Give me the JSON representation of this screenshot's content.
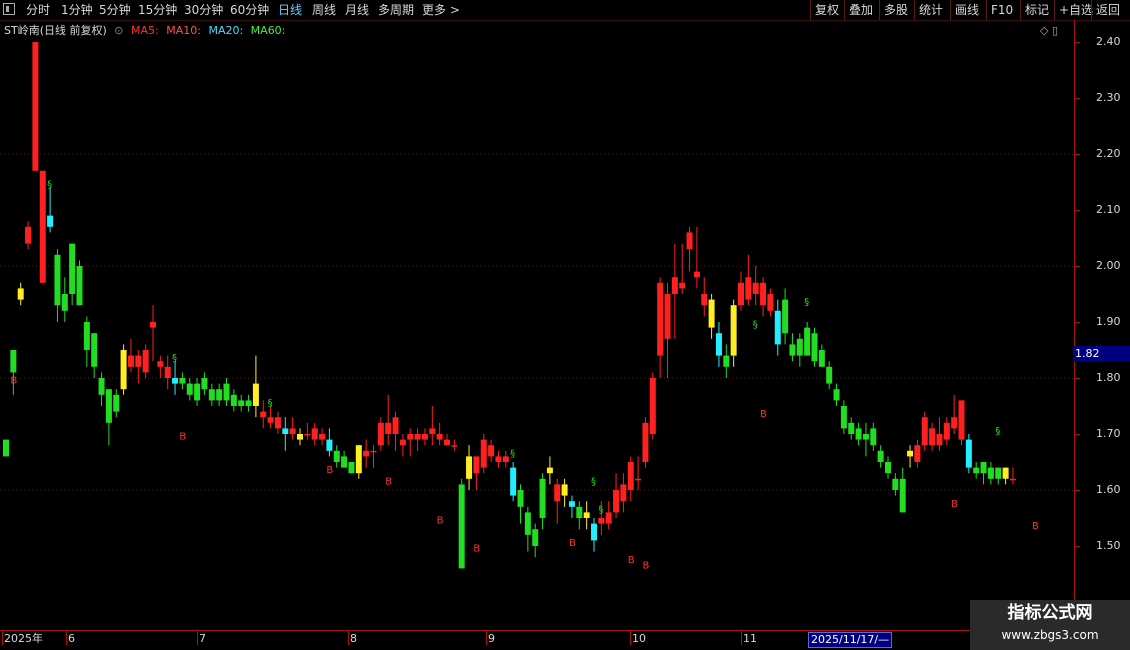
{
  "toolbar": {
    "left_items": [
      "分时",
      "1分钟",
      "5分钟",
      "15分钟",
      "30分钟",
      "60分钟",
      "日线",
      "周线",
      "月线",
      "多周期",
      "更多 >"
    ],
    "active": "日线",
    "right_items": [
      "复权",
      "叠加",
      "多股",
      "统计",
      "画线",
      "F10",
      "标记",
      "+自选",
      "返回"
    ]
  },
  "legend": {
    "stock": "ST岭南(日线 前复权)",
    "ma5": "MA5:",
    "ma10": "MA10:",
    "ma20": "MA20:",
    "ma60": "MA60:"
  },
  "colors": {
    "up": "#ff2020",
    "down": "#22dd22",
    "yellow": "#ffee22",
    "cyan": "#22eeff",
    "signal_b": "#ff3030",
    "signal_mark": "#22dd22"
  },
  "price_axis": {
    "labels": [
      "2.40",
      "2.30",
      "2.20",
      "2.10",
      "2.00",
      "1.90",
      "1.80",
      "1.70",
      "1.60",
      "1.50"
    ],
    "current_price": "1.82"
  },
  "x_axis": {
    "labels": [
      "2025年",
      "6",
      "7",
      "8",
      "9",
      "10",
      "11"
    ],
    "cursor_date": "2025/11/17/—"
  },
  "watermark": {
    "title": "指标公式网",
    "url": "www.zbgs3.com"
  },
  "chart_data": {
    "type": "candlestick",
    "ylim": [
      1.42,
      2.43
    ],
    "candles": [
      {
        "o": 1.66,
        "c": 1.69,
        "h": 1.69,
        "l": 1.66,
        "col": "down"
      },
      {
        "o": 1.81,
        "c": 1.85,
        "h": 1.85,
        "l": 1.77,
        "col": "down"
      },
      {
        "o": 1.94,
        "c": 1.96,
        "h": 1.97,
        "l": 1.93,
        "col": "yellow"
      },
      {
        "o": 2.04,
        "c": 2.07,
        "h": 2.08,
        "l": 2.03,
        "col": "up"
      },
      {
        "o": 2.17,
        "c": 2.4,
        "h": 2.4,
        "l": 2.17,
        "col": "up"
      },
      {
        "o": 1.97,
        "c": 2.17,
        "h": 2.17,
        "l": 1.97,
        "col": "up"
      },
      {
        "o": 2.09,
        "c": 2.07,
        "h": 2.14,
        "l": 2.06,
        "col": "cyan"
      },
      {
        "o": 2.02,
        "c": 1.93,
        "h": 2.03,
        "l": 1.9,
        "col": "down"
      },
      {
        "o": 1.95,
        "c": 1.92,
        "h": 1.98,
        "l": 1.9,
        "col": "down"
      },
      {
        "o": 2.04,
        "c": 1.95,
        "h": 2.04,
        "l": 1.93,
        "col": "down"
      },
      {
        "o": 2.0,
        "c": 1.93,
        "h": 2.01,
        "l": 1.93,
        "col": "down"
      },
      {
        "o": 1.9,
        "c": 1.85,
        "h": 1.91,
        "l": 1.82,
        "col": "down"
      },
      {
        "o": 1.88,
        "c": 1.82,
        "h": 1.88,
        "l": 1.8,
        "col": "down"
      },
      {
        "o": 1.8,
        "c": 1.77,
        "h": 1.81,
        "l": 1.75,
        "col": "down"
      },
      {
        "o": 1.78,
        "c": 1.72,
        "h": 1.78,
        "l": 1.68,
        "col": "down"
      },
      {
        "o": 1.74,
        "c": 1.77,
        "h": 1.78,
        "l": 1.73,
        "col": "down"
      },
      {
        "o": 1.78,
        "c": 1.85,
        "h": 1.86,
        "l": 1.77,
        "col": "yellow"
      },
      {
        "o": 1.82,
        "c": 1.84,
        "h": 1.87,
        "l": 1.81,
        "col": "up"
      },
      {
        "o": 1.84,
        "c": 1.82,
        "h": 1.85,
        "l": 1.79,
        "col": "up"
      },
      {
        "o": 1.85,
        "c": 1.81,
        "h": 1.86,
        "l": 1.8,
        "col": "up"
      },
      {
        "o": 1.9,
        "c": 1.89,
        "h": 1.93,
        "l": 1.83,
        "col": "up"
      },
      {
        "o": 1.83,
        "c": 1.82,
        "h": 1.84,
        "l": 1.8,
        "col": "up"
      },
      {
        "o": 1.82,
        "c": 1.8,
        "h": 1.84,
        "l": 1.78,
        "col": "up"
      },
      {
        "o": 1.8,
        "c": 1.79,
        "h": 1.83,
        "l": 1.77,
        "col": "cyan"
      },
      {
        "o": 1.8,
        "c": 1.79,
        "h": 1.81,
        "l": 1.78,
        "col": "down"
      },
      {
        "o": 1.79,
        "c": 1.77,
        "h": 1.8,
        "l": 1.76,
        "col": "down"
      },
      {
        "o": 1.79,
        "c": 1.76,
        "h": 1.8,
        "l": 1.75,
        "col": "down"
      },
      {
        "o": 1.8,
        "c": 1.78,
        "h": 1.81,
        "l": 1.77,
        "col": "down"
      },
      {
        "o": 1.78,
        "c": 1.76,
        "h": 1.79,
        "l": 1.75,
        "col": "down"
      },
      {
        "o": 1.78,
        "c": 1.76,
        "h": 1.79,
        "l": 1.75,
        "col": "down"
      },
      {
        "o": 1.79,
        "c": 1.76,
        "h": 1.8,
        "l": 1.75,
        "col": "down"
      },
      {
        "o": 1.77,
        "c": 1.75,
        "h": 1.78,
        "l": 1.74,
        "col": "down"
      },
      {
        "o": 1.76,
        "c": 1.75,
        "h": 1.77,
        "l": 1.74,
        "col": "down"
      },
      {
        "o": 1.76,
        "c": 1.75,
        "h": 1.77,
        "l": 1.74,
        "col": "down"
      },
      {
        "o": 1.75,
        "c": 1.79,
        "h": 1.84,
        "l": 1.73,
        "col": "yellow"
      },
      {
        "o": 1.74,
        "c": 1.73,
        "h": 1.76,
        "l": 1.71,
        "col": "up"
      },
      {
        "o": 1.73,
        "c": 1.72,
        "h": 1.75,
        "l": 1.71,
        "col": "up"
      },
      {
        "o": 1.73,
        "c": 1.71,
        "h": 1.74,
        "l": 1.7,
        "col": "up"
      },
      {
        "o": 1.71,
        "c": 1.7,
        "h": 1.73,
        "l": 1.67,
        "col": "cyan"
      },
      {
        "o": 1.71,
        "c": 1.7,
        "h": 1.73,
        "l": 1.69,
        "col": "up"
      },
      {
        "o": 1.7,
        "c": 1.69,
        "h": 1.71,
        "l": 1.68,
        "col": "yellow"
      },
      {
        "o": 1.7,
        "c": 1.7,
        "h": 1.72,
        "l": 1.69,
        "col": "up"
      },
      {
        "o": 1.71,
        "c": 1.69,
        "h": 1.72,
        "l": 1.68,
        "col": "up"
      },
      {
        "o": 1.7,
        "c": 1.69,
        "h": 1.71,
        "l": 1.68,
        "col": "up"
      },
      {
        "o": 1.69,
        "c": 1.67,
        "h": 1.71,
        "l": 1.66,
        "col": "cyan"
      },
      {
        "o": 1.67,
        "c": 1.65,
        "h": 1.68,
        "l": 1.64,
        "col": "down"
      },
      {
        "o": 1.66,
        "c": 1.64,
        "h": 1.67,
        "l": 1.64,
        "col": "down"
      },
      {
        "o": 1.65,
        "c": 1.63,
        "h": 1.65,
        "l": 1.63,
        "col": "down"
      },
      {
        "o": 1.63,
        "c": 1.68,
        "h": 1.68,
        "l": 1.62,
        "col": "yellow"
      },
      {
        "o": 1.66,
        "c": 1.67,
        "h": 1.69,
        "l": 1.64,
        "col": "up"
      },
      {
        "o": 1.67,
        "c": 1.67,
        "h": 1.68,
        "l": 1.64,
        "col": "up"
      },
      {
        "o": 1.68,
        "c": 1.72,
        "h": 1.73,
        "l": 1.67,
        "col": "up"
      },
      {
        "o": 1.72,
        "c": 1.7,
        "h": 1.77,
        "l": 1.68,
        "col": "up"
      },
      {
        "o": 1.7,
        "c": 1.73,
        "h": 1.74,
        "l": 1.67,
        "col": "up"
      },
      {
        "o": 1.68,
        "c": 1.69,
        "h": 1.7,
        "l": 1.66,
        "col": "up"
      },
      {
        "o": 1.7,
        "c": 1.69,
        "h": 1.71,
        "l": 1.66,
        "col": "up"
      },
      {
        "o": 1.7,
        "c": 1.69,
        "h": 1.71,
        "l": 1.67,
        "col": "up"
      },
      {
        "o": 1.7,
        "c": 1.69,
        "h": 1.71,
        "l": 1.68,
        "col": "up"
      },
      {
        "o": 1.7,
        "c": 1.71,
        "h": 1.75,
        "l": 1.68,
        "col": "up"
      },
      {
        "o": 1.7,
        "c": 1.69,
        "h": 1.72,
        "l": 1.68,
        "col": "up"
      },
      {
        "o": 1.69,
        "c": 1.68,
        "h": 1.7,
        "l": 1.68,
        "col": "up"
      },
      {
        "o": 1.68,
        "c": 1.68,
        "h": 1.69,
        "l": 1.67,
        "col": "up"
      },
      {
        "o": 1.61,
        "c": 1.46,
        "h": 1.62,
        "l": 1.46,
        "col": "down"
      },
      {
        "o": 1.62,
        "c": 1.66,
        "h": 1.68,
        "l": 1.6,
        "col": "yellow"
      },
      {
        "o": 1.66,
        "c": 1.63,
        "h": 1.66,
        "l": 1.6,
        "col": "up"
      },
      {
        "o": 1.64,
        "c": 1.69,
        "h": 1.7,
        "l": 1.63,
        "col": "up"
      },
      {
        "o": 1.66,
        "c": 1.68,
        "h": 1.69,
        "l": 1.65,
        "col": "up"
      },
      {
        "o": 1.66,
        "c": 1.65,
        "h": 1.67,
        "l": 1.64,
        "col": "up"
      },
      {
        "o": 1.66,
        "c": 1.65,
        "h": 1.67,
        "l": 1.64,
        "col": "up"
      },
      {
        "o": 1.64,
        "c": 1.59,
        "h": 1.65,
        "l": 1.58,
        "col": "cyan"
      },
      {
        "o": 1.6,
        "c": 1.57,
        "h": 1.61,
        "l": 1.54,
        "col": "down"
      },
      {
        "o": 1.56,
        "c": 1.52,
        "h": 1.57,
        "l": 1.49,
        "col": "down"
      },
      {
        "o": 1.53,
        "c": 1.5,
        "h": 1.54,
        "l": 1.48,
        "col": "down"
      },
      {
        "o": 1.55,
        "c": 1.62,
        "h": 1.63,
        "l": 1.53,
        "col": "down"
      },
      {
        "o": 1.63,
        "c": 1.64,
        "h": 1.66,
        "l": 1.61,
        "col": "yellow"
      },
      {
        "o": 1.58,
        "c": 1.61,
        "h": 1.62,
        "l": 1.54,
        "col": "up"
      },
      {
        "o": 1.61,
        "c": 1.59,
        "h": 1.62,
        "l": 1.57,
        "col": "yellow"
      },
      {
        "o": 1.58,
        "c": 1.57,
        "h": 1.59,
        "l": 1.55,
        "col": "cyan"
      },
      {
        "o": 1.57,
        "c": 1.55,
        "h": 1.58,
        "l": 1.53,
        "col": "down"
      },
      {
        "o": 1.56,
        "c": 1.55,
        "h": 1.58,
        "l": 1.53,
        "col": "yellow"
      },
      {
        "o": 1.54,
        "c": 1.51,
        "h": 1.55,
        "l": 1.49,
        "col": "cyan"
      },
      {
        "o": 1.54,
        "c": 1.55,
        "h": 1.58,
        "l": 1.52,
        "col": "up"
      },
      {
        "o": 1.54,
        "c": 1.56,
        "h": 1.58,
        "l": 1.53,
        "col": "up"
      },
      {
        "o": 1.56,
        "c": 1.6,
        "h": 1.63,
        "l": 1.55,
        "col": "up"
      },
      {
        "o": 1.58,
        "c": 1.61,
        "h": 1.63,
        "l": 1.56,
        "col": "up"
      },
      {
        "o": 1.6,
        "c": 1.65,
        "h": 1.66,
        "l": 1.58,
        "col": "up"
      },
      {
        "o": 1.62,
        "c": 1.62,
        "h": 1.66,
        "l": 1.6,
        "col": "up"
      },
      {
        "o": 1.65,
        "c": 1.72,
        "h": 1.73,
        "l": 1.64,
        "col": "up"
      },
      {
        "o": 1.7,
        "c": 1.8,
        "h": 1.81,
        "l": 1.69,
        "col": "up"
      },
      {
        "o": 1.84,
        "c": 1.97,
        "h": 1.98,
        "l": 1.8,
        "col": "up"
      },
      {
        "o": 1.95,
        "c": 1.87,
        "h": 1.97,
        "l": 1.8,
        "col": "up"
      },
      {
        "o": 1.95,
        "c": 1.98,
        "h": 2.04,
        "l": 1.87,
        "col": "up"
      },
      {
        "o": 1.97,
        "c": 1.96,
        "h": 2.04,
        "l": 1.95,
        "col": "up"
      },
      {
        "o": 2.03,
        "c": 2.06,
        "h": 2.07,
        "l": 1.99,
        "col": "up"
      },
      {
        "o": 1.99,
        "c": 1.98,
        "h": 2.07,
        "l": 1.96,
        "col": "up"
      },
      {
        "o": 1.95,
        "c": 1.93,
        "h": 1.98,
        "l": 1.91,
        "col": "up"
      },
      {
        "o": 1.94,
        "c": 1.89,
        "h": 1.95,
        "l": 1.87,
        "col": "yellow"
      },
      {
        "o": 1.88,
        "c": 1.84,
        "h": 1.9,
        "l": 1.82,
        "col": "cyan"
      },
      {
        "o": 1.84,
        "c": 1.82,
        "h": 1.86,
        "l": 1.8,
        "col": "down"
      },
      {
        "o": 1.84,
        "c": 1.93,
        "h": 1.94,
        "l": 1.82,
        "col": "yellow"
      },
      {
        "o": 1.93,
        "c": 1.97,
        "h": 1.99,
        "l": 1.92,
        "col": "up"
      },
      {
        "o": 1.94,
        "c": 1.98,
        "h": 2.02,
        "l": 1.93,
        "col": "up"
      },
      {
        "o": 1.97,
        "c": 1.95,
        "h": 2.0,
        "l": 1.93,
        "col": "up"
      },
      {
        "o": 1.97,
        "c": 1.93,
        "h": 1.98,
        "l": 1.91,
        "col": "up"
      },
      {
        "o": 1.95,
        "c": 1.92,
        "h": 1.96,
        "l": 1.91,
        "col": "up"
      },
      {
        "o": 1.92,
        "c": 1.86,
        "h": 1.94,
        "l": 1.84,
        "col": "cyan"
      },
      {
        "o": 1.94,
        "c": 1.88,
        "h": 1.96,
        "l": 1.86,
        "col": "down"
      },
      {
        "o": 1.86,
        "c": 1.84,
        "h": 1.88,
        "l": 1.83,
        "col": "down"
      },
      {
        "o": 1.87,
        "c": 1.84,
        "h": 1.88,
        "l": 1.82,
        "col": "down"
      },
      {
        "o": 1.89,
        "c": 1.84,
        "h": 1.9,
        "l": 1.84,
        "col": "down"
      },
      {
        "o": 1.88,
        "c": 1.83,
        "h": 1.89,
        "l": 1.82,
        "col": "down"
      },
      {
        "o": 1.85,
        "c": 1.82,
        "h": 1.86,
        "l": 1.82,
        "col": "down"
      },
      {
        "o": 1.82,
        "c": 1.79,
        "h": 1.83,
        "l": 1.78,
        "col": "down"
      },
      {
        "o": 1.78,
        "c": 1.76,
        "h": 1.79,
        "l": 1.75,
        "col": "down"
      },
      {
        "o": 1.75,
        "c": 1.71,
        "h": 1.76,
        "l": 1.7,
        "col": "down"
      },
      {
        "o": 1.72,
        "c": 1.7,
        "h": 1.73,
        "l": 1.69,
        "col": "down"
      },
      {
        "o": 1.71,
        "c": 1.69,
        "h": 1.72,
        "l": 1.68,
        "col": "down"
      },
      {
        "o": 1.7,
        "c": 1.69,
        "h": 1.72,
        "l": 1.66,
        "col": "down"
      },
      {
        "o": 1.71,
        "c": 1.68,
        "h": 1.72,
        "l": 1.67,
        "col": "down"
      },
      {
        "o": 1.67,
        "c": 1.65,
        "h": 1.68,
        "l": 1.64,
        "col": "down"
      },
      {
        "o": 1.65,
        "c": 1.63,
        "h": 1.66,
        "l": 1.62,
        "col": "down"
      },
      {
        "o": 1.62,
        "c": 1.6,
        "h": 1.63,
        "l": 1.59,
        "col": "down"
      },
      {
        "o": 1.62,
        "c": 1.56,
        "h": 1.64,
        "l": 1.56,
        "col": "down"
      },
      {
        "o": 1.66,
        "c": 1.67,
        "h": 1.68,
        "l": 1.64,
        "col": "yellow"
      },
      {
        "o": 1.65,
        "c": 1.68,
        "h": 1.69,
        "l": 1.64,
        "col": "up"
      },
      {
        "o": 1.68,
        "c": 1.73,
        "h": 1.74,
        "l": 1.67,
        "col": "up"
      },
      {
        "o": 1.68,
        "c": 1.71,
        "h": 1.72,
        "l": 1.67,
        "col": "up"
      },
      {
        "o": 1.7,
        "c": 1.68,
        "h": 1.73,
        "l": 1.67,
        "col": "up"
      },
      {
        "o": 1.69,
        "c": 1.72,
        "h": 1.73,
        "l": 1.68,
        "col": "up"
      },
      {
        "o": 1.73,
        "c": 1.71,
        "h": 1.77,
        "l": 1.7,
        "col": "up"
      },
      {
        "o": 1.76,
        "c": 1.69,
        "h": 1.76,
        "l": 1.68,
        "col": "up"
      },
      {
        "o": 1.69,
        "c": 1.64,
        "h": 1.7,
        "l": 1.63,
        "col": "cyan"
      },
      {
        "o": 1.64,
        "c": 1.63,
        "h": 1.65,
        "l": 1.62,
        "col": "down"
      },
      {
        "o": 1.65,
        "c": 1.63,
        "h": 1.65,
        "l": 1.61,
        "col": "down"
      },
      {
        "o": 1.64,
        "c": 1.62,
        "h": 1.65,
        "l": 1.61,
        "col": "down"
      },
      {
        "o": 1.64,
        "c": 1.62,
        "h": 1.64,
        "l": 1.61,
        "col": "down"
      },
      {
        "o": 1.64,
        "c": 1.62,
        "h": 1.64,
        "l": 1.61,
        "col": "yellow"
      },
      {
        "o": 1.62,
        "c": 1.62,
        "h": 1.64,
        "l": 1.61,
        "col": "up"
      }
    ],
    "markers": [
      {
        "i": 1,
        "type": "B",
        "price": 1.79
      },
      {
        "i": 6,
        "type": "mark",
        "price": 2.14
      },
      {
        "i": 24,
        "type": "B",
        "price": 1.69
      },
      {
        "i": 23,
        "type": "mark",
        "price": 1.83
      },
      {
        "i": 44,
        "type": "B",
        "price": 1.63
      },
      {
        "i": 36,
        "type": "mark",
        "price": 1.75
      },
      {
        "i": 52,
        "type": "B",
        "price": 1.61
      },
      {
        "i": 59,
        "type": "B",
        "price": 1.54
      },
      {
        "i": 64,
        "type": "B",
        "price": 1.49
      },
      {
        "i": 69,
        "type": "mark",
        "price": 1.66
      },
      {
        "i": 77,
        "type": "B",
        "price": 1.5
      },
      {
        "i": 80,
        "type": "mark",
        "price": 1.61
      },
      {
        "i": 85,
        "type": "B",
        "price": 1.47
      },
      {
        "i": 87,
        "type": "B",
        "price": 1.46
      },
      {
        "i": 81,
        "type": "mark",
        "price": 1.56
      },
      {
        "i": 103,
        "type": "B",
        "price": 1.73
      },
      {
        "i": 102,
        "type": "mark",
        "price": 1.89
      },
      {
        "i": 109,
        "type": "mark",
        "price": 1.93
      },
      {
        "i": 129,
        "type": "B",
        "price": 1.57
      },
      {
        "i": 135,
        "type": "mark",
        "price": 1.7
      },
      {
        "i": 140,
        "type": "B",
        "price": 1.53
      }
    ]
  }
}
